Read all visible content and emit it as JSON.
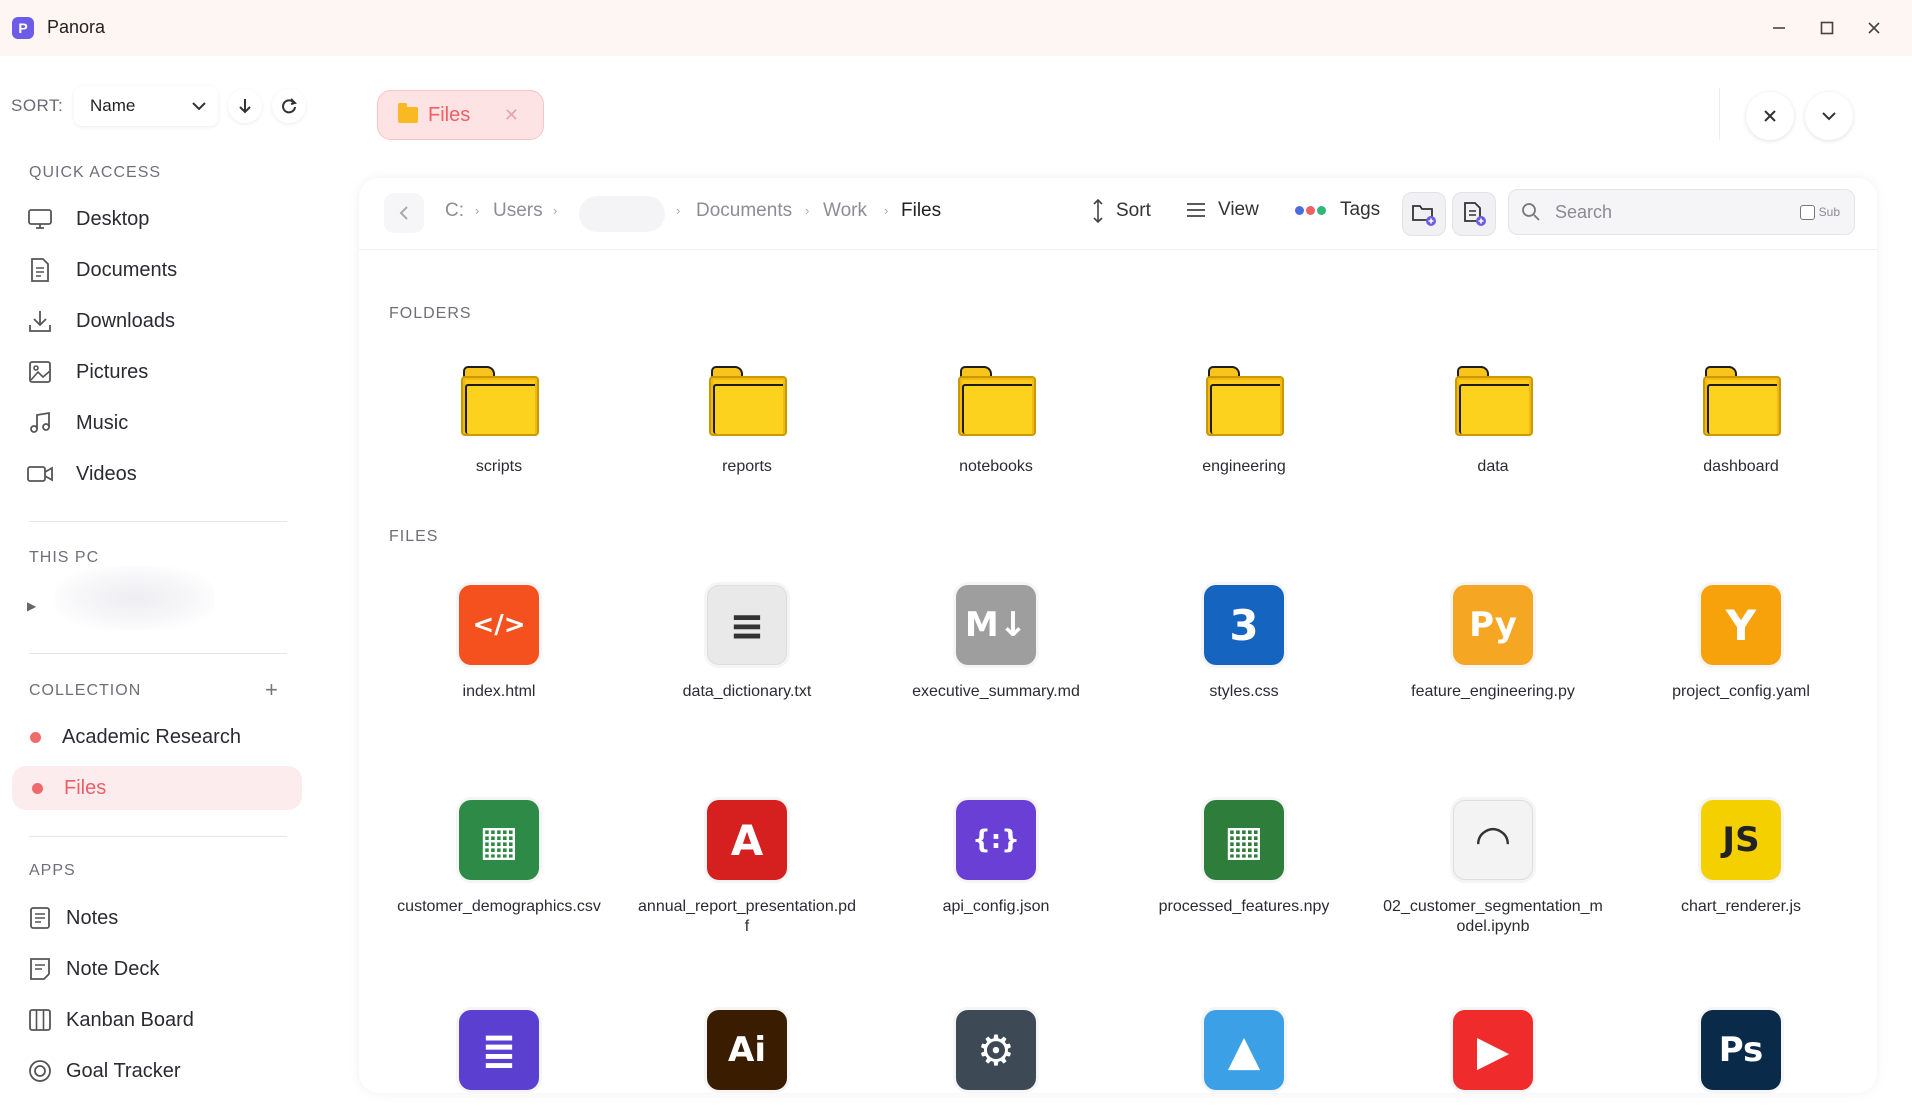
{
  "window": {
    "title": "Panora",
    "logo_letter": "P"
  },
  "sidebar": {
    "sort_label": "SORT:",
    "sort_value": "Name",
    "quick_access_title": "QUICK ACCESS",
    "quick_access": [
      {
        "label": "Desktop",
        "icon": "monitor-icon"
      },
      {
        "label": "Documents",
        "icon": "document-icon"
      },
      {
        "label": "Downloads",
        "icon": "download-icon"
      },
      {
        "label": "Pictures",
        "icon": "image-icon"
      },
      {
        "label": "Music",
        "icon": "music-icon"
      },
      {
        "label": "Videos",
        "icon": "video-icon"
      }
    ],
    "this_pc_title": "THIS PC",
    "collection_title": "COLLECTION",
    "collections": [
      {
        "label": "Academic Research",
        "color": "#ef6b6b"
      },
      {
        "label": "Files",
        "color": "#ef6b6b",
        "active": true
      }
    ],
    "apps_title": "APPS",
    "apps": [
      {
        "label": "Notes",
        "icon": "notes-icon"
      },
      {
        "label": "Note Deck",
        "icon": "note-deck-icon"
      },
      {
        "label": "Kanban Board",
        "icon": "kanban-icon"
      },
      {
        "label": "Goal Tracker",
        "icon": "target-icon"
      }
    ]
  },
  "tab": {
    "label": "Files",
    "accent": "#ef5f66"
  },
  "toolbar": {
    "breadcrumb": [
      "C:",
      "Users",
      "Documents",
      "Work",
      "Files"
    ],
    "sort_label": "Sort",
    "view_label": "View",
    "tags_label": "Tags",
    "tag_colors": [
      "#4a6ee0",
      "#ef5f66",
      "#2fb67a"
    ],
    "search_placeholder": "Search",
    "sub_label": "Sub"
  },
  "content": {
    "folders_title": "FOLDERS",
    "folders": [
      "scripts",
      "reports",
      "notebooks",
      "engineering",
      "data",
      "dashboard"
    ],
    "files_title": "FILES",
    "files": [
      {
        "name": "index.html",
        "icon": "html-icon",
        "glyph": "</>",
        "color": "#f4511e"
      },
      {
        "name": "data_dictionary.txt",
        "icon": "text-file-icon",
        "glyph": "≡",
        "color": "#e9e9e9"
      },
      {
        "name": "executive_summary.md",
        "icon": "markdown-icon",
        "glyph": "M↓",
        "color": "#9e9e9e"
      },
      {
        "name": "styles.css",
        "icon": "css-icon",
        "glyph": "3",
        "color": "#1565c0"
      },
      {
        "name": "feature_engineering.py",
        "icon": "python-icon",
        "glyph": "Py",
        "color": "#f5a623"
      },
      {
        "name": "project_config.yaml",
        "icon": "yaml-icon",
        "glyph": "Y",
        "color": "#f7a20a"
      },
      {
        "name": "customer_demographics.csv",
        "icon": "csv-icon",
        "glyph": "▦",
        "color": "#2e8b47"
      },
      {
        "name": "annual_report_presentation.pdf",
        "icon": "pdf-icon",
        "glyph": "A",
        "color": "#d61f1f"
      },
      {
        "name": "api_config.json",
        "icon": "json-icon",
        "glyph": "{:}",
        "color": "#6a3fd6"
      },
      {
        "name": "processed_features.npy",
        "icon": "numpy-icon",
        "glyph": "▦",
        "color": "#2f7d3b"
      },
      {
        "name": "02_customer_segmentation_model.ipynb",
        "icon": "jupyter-icon",
        "glyph": "◠",
        "color": "#f3f3f3"
      },
      {
        "name": "chart_renderer.js",
        "icon": "javascript-icon",
        "glyph": "JS",
        "color": "#f5d000"
      },
      {
        "name": "",
        "icon": "database-icon",
        "glyph": "≣",
        "color": "#5a3fd0"
      },
      {
        "name": "",
        "icon": "illustrator-icon",
        "glyph": "Ai",
        "color": "#3a1d00"
      },
      {
        "name": "",
        "icon": "settings-file-icon",
        "glyph": "⚙",
        "color": "#3d4a55"
      },
      {
        "name": "",
        "icon": "image-file-icon",
        "glyph": "▲",
        "color": "#3ba0e6"
      },
      {
        "name": "",
        "icon": "video-file-icon",
        "glyph": "▶",
        "color": "#ef2b2b"
      },
      {
        "name": "",
        "icon": "photoshop-icon",
        "glyph": "Ps",
        "color": "#0a2a4a"
      }
    ]
  }
}
